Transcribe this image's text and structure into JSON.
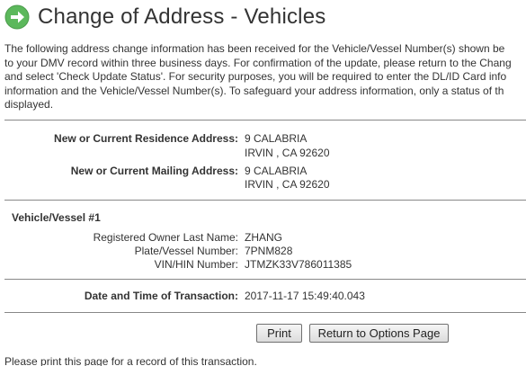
{
  "header": {
    "title": "Change of Address - Vehicles",
    "icon": "arrow-right-circle-icon",
    "icon_color": "#5cb85c"
  },
  "intro": {
    "lines": [
      "The following address change information has been received for the Vehicle/Vessel Number(s) shown be",
      "to your DMV record within three business days. For confirmation of the update, please return to the Chang",
      "and select 'Check Update Status'. For security purposes, you will be required to enter the DL/ID Card info",
      "information and the Vehicle/Vessel Number(s). To safeguard your address information, only a status of th",
      "displayed."
    ]
  },
  "addresses": {
    "residence_label": "New or Current Residence Address:",
    "residence_line1": "9 CALABRIA",
    "residence_line2": "IRVIN , CA 92620",
    "mailing_label": "New or Current Mailing Address:",
    "mailing_line1": "9 CALABRIA",
    "mailing_line2": "IRVIN , CA 92620"
  },
  "vehicle": {
    "section_title": "Vehicle/Vessel #1",
    "owner_label": "Registered Owner Last Name:",
    "owner_value": "ZHANG",
    "plate_label": "Plate/Vessel Number:",
    "plate_value": "7PNM828",
    "vin_label": "VIN/HIN Number:",
    "vin_value": "JTMZK33V786011385"
  },
  "transaction": {
    "label": "Date and Time of Transaction:",
    "value": "2017-11-17 15:49:40.043"
  },
  "buttons": {
    "print_label": "Print",
    "return_label": "Return to Options Page"
  },
  "footer": {
    "text": "Please print this page for a record of this transaction."
  }
}
